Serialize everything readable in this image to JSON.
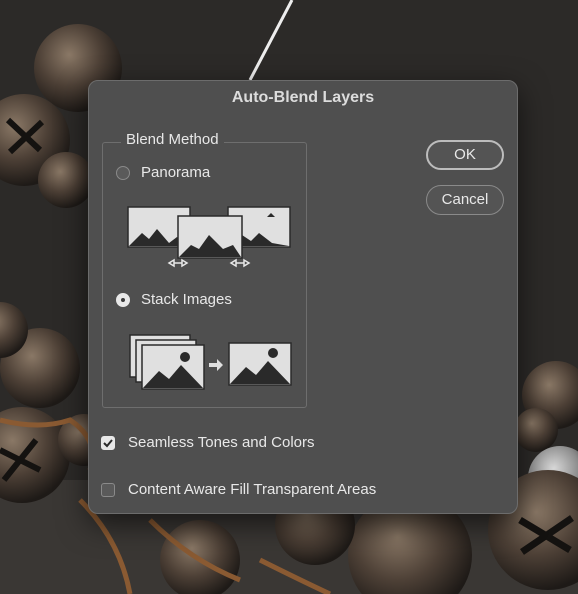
{
  "dialog": {
    "title": "Auto-Blend Layers",
    "blend_method": {
      "legend": "Blend Method",
      "options": [
        {
          "label": "Panorama",
          "selected": false
        },
        {
          "label": "Stack Images",
          "selected": true
        }
      ]
    },
    "buttons": {
      "ok": "OK",
      "cancel": "Cancel"
    },
    "checkboxes": [
      {
        "label": "Seamless Tones and Colors",
        "checked": true
      },
      {
        "label": "Content Aware Fill Transparent Areas",
        "checked": false
      }
    ]
  },
  "icons": [
    "panorama-illustration",
    "stack-images-illustration",
    "checkmark-icon"
  ],
  "colors": {
    "dialog_bg": "#4f4f4f",
    "text": "#e8e8e8",
    "backdrop": "#2e2c2a"
  }
}
